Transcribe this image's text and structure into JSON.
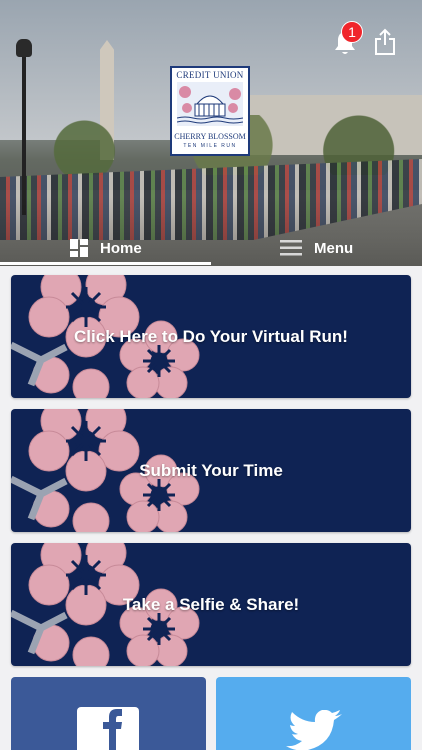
{
  "header": {
    "notification_count": "1",
    "logo": {
      "line1": "CREDIT UNION",
      "line2": "CHERRY BLOSSOM",
      "line3": "TEN MILE RUN"
    }
  },
  "tabs": [
    {
      "label": "Home",
      "icon": "dashboard-icon",
      "active": true
    },
    {
      "label": "Menu",
      "icon": "hamburger-icon",
      "active": false
    }
  ],
  "cards": [
    {
      "label": "Click Here to Do Your Virtual Run!"
    },
    {
      "label": "Submit Your Time"
    },
    {
      "label": "Take a Selfie & Share!"
    }
  ],
  "social": [
    {
      "name": "facebook",
      "icon": "facebook-icon",
      "color": "#3b5998"
    },
    {
      "name": "twitter",
      "icon": "twitter-icon",
      "color": "#55acee"
    }
  ],
  "colors": {
    "card_bg": "#0f2354",
    "blossom": "#e0a6b3",
    "badge": "#f0252b"
  }
}
